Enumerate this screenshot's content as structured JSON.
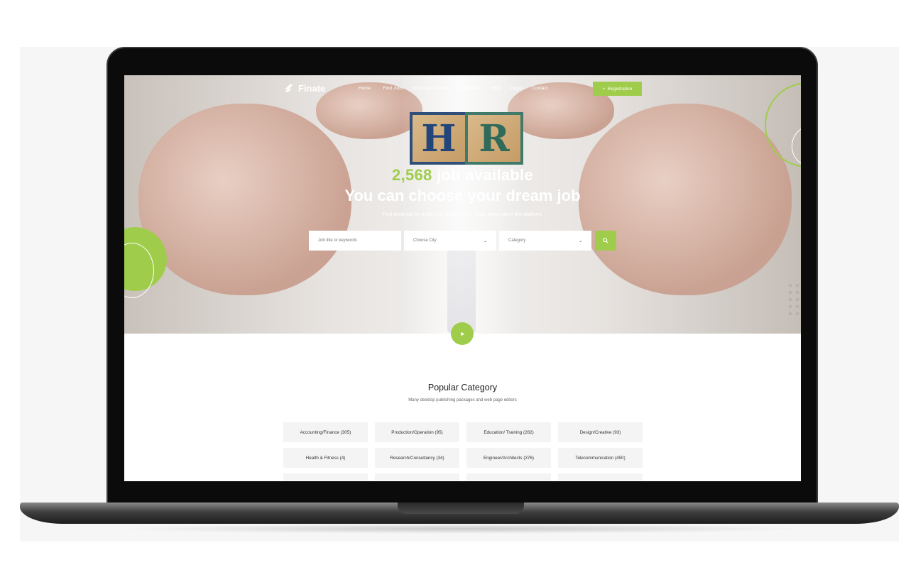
{
  "site": {
    "logo_text": "Finate"
  },
  "nav": {
    "links": [
      "Home",
      "Find Jobs",
      "Employers Details",
      "Candidates",
      "Blog",
      "Pages",
      "Contact"
    ],
    "registration_label": "Registration"
  },
  "hero": {
    "job_count": "2,568",
    "job_count_suffix": " job available",
    "title": "You can choose your dream job",
    "subtitle": "Find great job for build your bright career. Have many job in this platform.",
    "block_letters": [
      "H",
      "R"
    ]
  },
  "search": {
    "keyword_placeholder": "Job title or keywords",
    "city_value": "Choose City",
    "category_value": "Category"
  },
  "categories_section": {
    "title": "Popular Category",
    "subtitle": "Many desktop publishing packages and web page editors",
    "items": [
      "Accounting/Finance (305)",
      "Production/Operation (95)",
      "Education/ Training (282)",
      "Design/Creative (93)",
      "Health & Fitness (4)",
      "Research/Consultancy (34)",
      "Engineer/Architects (376)",
      "Telecommunication (450)"
    ]
  },
  "colors": {
    "accent": "#9fcd4b",
    "text_dark": "#1f1f1f"
  },
  "icons": {
    "logo": "leaf-logo-icon",
    "search": "search-icon",
    "play": "play-icon",
    "chevron": "chevron-down-icon"
  }
}
